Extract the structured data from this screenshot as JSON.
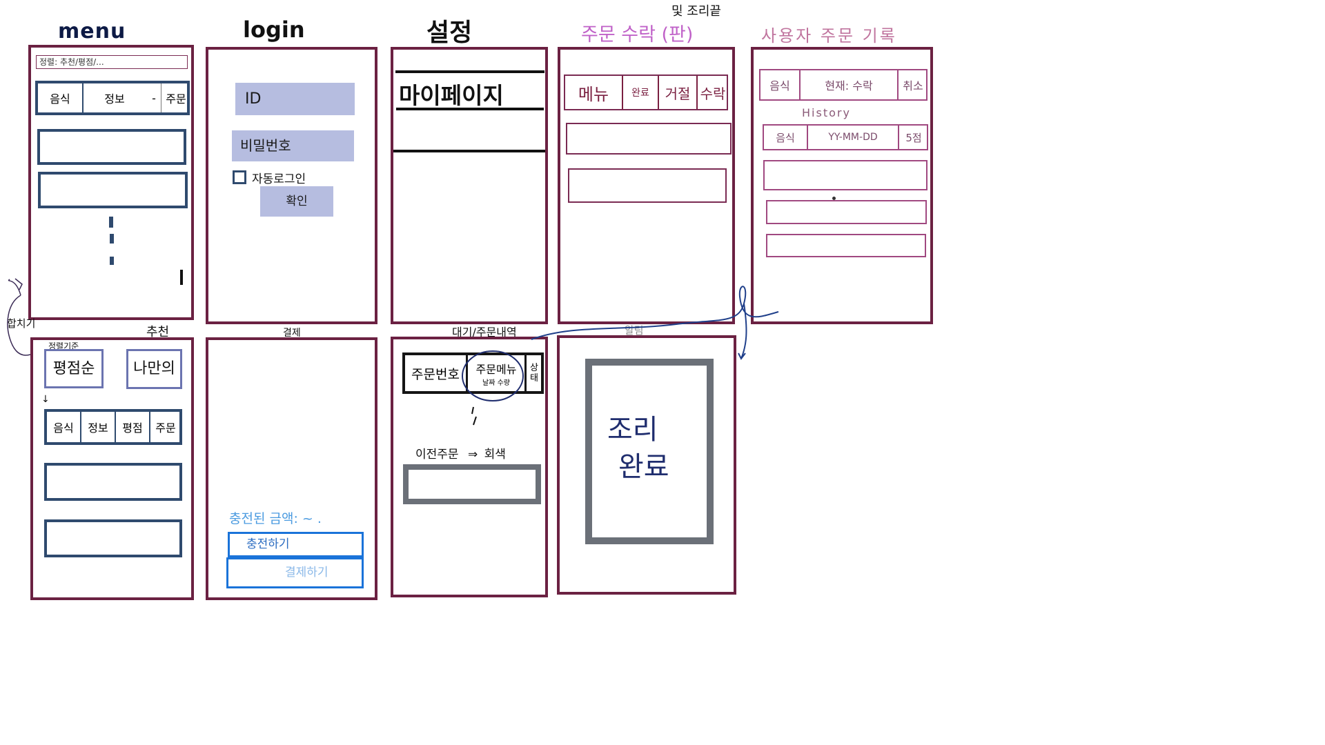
{
  "titles": {
    "menu": "menu",
    "login": "login",
    "settings": "설정",
    "order_accept": "주문 수락 (판)",
    "order_accept_note": "및 조리끝",
    "user_history": "사용자 주문 기록",
    "recommend": "추천",
    "payment": "결제",
    "waiting": "대기/주문내역",
    "notify": "알림"
  },
  "menu_screen": {
    "sort_bar": "정렬: 추천/평점/...",
    "header_cells": [
      "음식",
      "정보",
      "-",
      "주문"
    ]
  },
  "login_screen": {
    "id_label": "ID",
    "password_label": "비밀번호",
    "auto_login_label": "자동로그인",
    "confirm_button": "확인"
  },
  "settings_screen": {
    "mypage_label": "마이페이지"
  },
  "order_accept_screen": {
    "header_cells": [
      "메뉴",
      "완료",
      "거절",
      "수락"
    ]
  },
  "history_screen": {
    "header_cells": [
      "음식",
      "현재: 수락",
      "취소"
    ],
    "history_label": "History",
    "history_row": [
      "음식",
      "YY-MM-DD",
      "5점"
    ]
  },
  "annotations": {
    "combine": "합치기",
    "sort_criteria": "정렬기준"
  },
  "recommend_screen": {
    "rating_button": "평점순",
    "age_button": "나만의",
    "header_cells": [
      "음식",
      "정보",
      "평점",
      "주문"
    ]
  },
  "payment_screen": {
    "charged_amount": "충전된 금액: ~ .",
    "charge_button": "충전하기",
    "pay_button": "결제하기"
  },
  "waiting_screen": {
    "order_number": "주문번호",
    "order_menu": "주문메뉴",
    "order_menu_sub": "날짜 수량",
    "status": "상태",
    "previous_orders": "이전주문",
    "arrow": "⇒",
    "gray_note": "회색"
  },
  "notify_screen": {
    "cook_done_line1": "조리",
    "cook_done_line2": "완료"
  },
  "colors": {
    "frame": "#6b2142",
    "navy": "#2f4a6e",
    "lavender": "#b6bde0",
    "magenta": "#b84fb0",
    "pink_text": "#a04880",
    "blue_button": "#1a73d9",
    "light_blue_text": "#4b9be0",
    "gray_frame": "#6b7078",
    "handwriting_blue": "#1f2d6e"
  },
  "icons": [
    "checkbox-icon",
    "down-arrow-icon",
    "combine-arrow-icon",
    "flow-arrow-icon",
    "cursor-bar-icon"
  ]
}
